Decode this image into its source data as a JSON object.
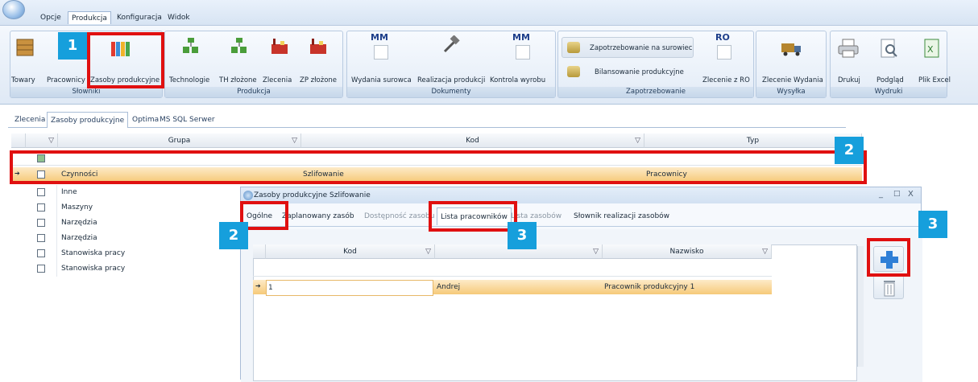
{
  "menu": {
    "items": [
      "Opcje",
      "Produkcja",
      "Konfiguracja",
      "Widok"
    ]
  },
  "ribbon": {
    "groups": [
      {
        "caption": "Słowniki",
        "buttons": [
          "Towary",
          "Pracownicy",
          "Zasoby produkcyjne"
        ]
      },
      {
        "caption": "Produkcja",
        "buttons": [
          "Technologie",
          "TH złożone",
          "Zlecenia",
          "ZP złożone"
        ]
      },
      {
        "caption": "Dokumenty",
        "buttons": [
          "Wydania surowca",
          "Realizacja produkcji",
          "Kontrola wyrobu"
        ],
        "icon_text": [
          "MM",
          "MM"
        ]
      },
      {
        "caption": "Zapotrzebowanie",
        "buttons": [
          "Zapotrzebowanie na surowiec",
          "Bilansowanie produkcyjne",
          "Zlecenie z RO"
        ],
        "icon_text": "RO"
      },
      {
        "caption": "Wysyłka",
        "buttons": [
          "Zlecenie Wydania"
        ]
      },
      {
        "caption": "Wydruki",
        "buttons": [
          "Drukuj",
          "Podgląd",
          "Plik Excel"
        ]
      }
    ]
  },
  "tabs": [
    "Zlecenia",
    "Zasoby produkcyjne",
    "Optima",
    "MS SQL Serwer"
  ],
  "grid": {
    "columns": [
      "Grupa",
      "Kod",
      "Typ"
    ],
    "selected_row": {
      "grupa": "Czynności",
      "kod": "Szlifowanie",
      "typ": "Pracownicy"
    },
    "rows": [
      "Inne",
      "Maszyny",
      "Narzędzia",
      "Narzędzia",
      "Stanowiska pracy",
      "Stanowiska pracy"
    ]
  },
  "dialog": {
    "title": "Zasoby produkcyjne Szlifowanie",
    "tabs": [
      "Ogólne",
      "Zaplanowany zasób",
      "Dostępność zasobu",
      "Lista pracowników",
      "Lista zasobów",
      "Słownik realizacji zasobów"
    ],
    "columns": [
      "Kod",
      "",
      "Nazwisko"
    ],
    "row": {
      "kod": "1",
      "imie": "Andrej",
      "nazwisko": "Pracownik produkcyjny 1"
    },
    "window_controls": [
      "_",
      "□",
      "X"
    ]
  },
  "badges": [
    "1",
    "2",
    "2",
    "3",
    "3"
  ],
  "colors": {
    "badge": "#169fdc",
    "highlight": "#e01010",
    "selected_row": "#f6c979"
  }
}
